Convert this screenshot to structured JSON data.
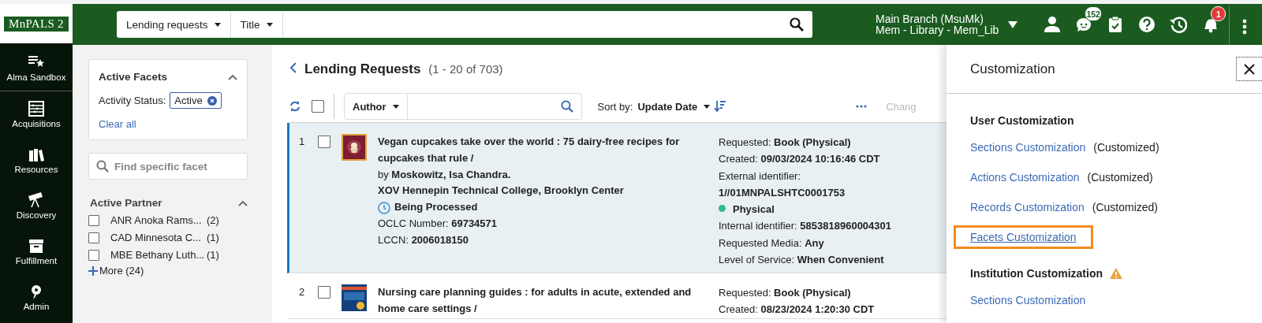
{
  "topbar": {
    "logo": "MnPALS 2",
    "search": {
      "scope": "Lending requests",
      "field": "Title"
    },
    "location": {
      "line_1": "Main Branch (MsuMk)",
      "line_2": "Mem - Library - Mem_Lib"
    },
    "icons": [
      {
        "kind": "user"
      },
      {
        "kind": "chat",
        "badge": "152"
      },
      {
        "kind": "tasks"
      },
      {
        "kind": "help"
      },
      {
        "kind": "history"
      },
      {
        "kind": "alerts",
        "badge": "1"
      },
      {
        "kind": "more"
      }
    ]
  },
  "nav": {
    "items": [
      {
        "label": "Alma Sandbox",
        "kind": "sandbox"
      },
      {
        "label": "Acquisitions",
        "kind": "acquisitions"
      },
      {
        "label": "Resources",
        "kind": "resources"
      },
      {
        "label": "Discovery",
        "kind": "discovery"
      },
      {
        "label": "Fulfillment",
        "kind": "fulfillment"
      },
      {
        "label": "Admin",
        "kind": "admin"
      }
    ]
  },
  "facets": {
    "active": {
      "title": "Active Facets",
      "expanded": true,
      "filter_label": "Activity Status:",
      "filter_value": "Active",
      "clear": "Clear all"
    },
    "find_placeholder": "Find specific facet",
    "groups": [
      {
        "title": "Active Partner",
        "expanded": true,
        "items": [
          {
            "label": "ANR Anoka Rams...",
            "count": "(2)",
            "checked": false
          },
          {
            "label": "CAD Minnesota C...",
            "count": "(1)",
            "checked": false
          },
          {
            "label": "MBE Bethany Luth...",
            "count": "(1)",
            "checked": false
          }
        ],
        "more": "More (24)"
      }
    ]
  },
  "list": {
    "title": "Lending Requests",
    "range": "(1 - 20 of 703)",
    "toolbar": {
      "select_all_checked": false,
      "search_field": "Author",
      "sort_label": "Sort by:",
      "sort_value": "Update Date",
      "change": "Chang"
    },
    "rows": [
      {
        "number": "1",
        "checked": false,
        "selected": true,
        "title": "Vegan cupcakes take over the world : 75 dairy-free recipes for cupcakes that rule /",
        "by": "by",
        "author": "Moskowitz, Isa Chandra.",
        "partner": "XOV Hennepin Technical College, Brooklyn Center",
        "status": "Being Processed",
        "ids": [
          {
            "label": "OCLC Number:",
            "value": "69734571"
          },
          {
            "label": "LCCN:",
            "value": "2006018150"
          }
        ],
        "details": [
          {
            "kind": "pair",
            "label": "Requested:",
            "value": "Book (Physical)"
          },
          {
            "kind": "pair",
            "label": "Created:",
            "value": "09/03/2024 10:16:46 CDT"
          },
          {
            "kind": "label",
            "label": "External identifier:"
          },
          {
            "kind": "value",
            "value": "1//01MNPALSHTC0001753"
          },
          {
            "kind": "dot",
            "value": "Physical",
            "color": "#2dbd8b"
          },
          {
            "kind": "pair",
            "label": "Internal identifier:",
            "value": "5853818960004301"
          },
          {
            "kind": "pair",
            "label": "Requested Media:",
            "value": "Any"
          },
          {
            "kind": "pair",
            "label": "Level of Service:",
            "value": "When Convenient"
          }
        ]
      },
      {
        "number": "2",
        "checked": false,
        "selected": false,
        "title": "Nursing care planning guides : for adults in acute, extended and home care settings /",
        "details": [
          {
            "kind": "pair",
            "label": "Requested:",
            "value": "Book (Physical)"
          },
          {
            "kind": "pair",
            "label": "Created:",
            "value": "08/23/2024 1:20:30 CDT"
          }
        ]
      }
    ]
  },
  "customization": {
    "title": "Customization",
    "sections": [
      {
        "title": "User Customization",
        "warning": false,
        "links": [
          {
            "label": "Sections Customization",
            "note": "(Customized)",
            "highlighted": false
          },
          {
            "label": "Actions Customization",
            "note": "(Customized)",
            "highlighted": false
          },
          {
            "label": "Records Customization",
            "note": "(Customized)",
            "highlighted": false
          },
          {
            "label": "Facets Customization",
            "highlighted": true
          }
        ]
      },
      {
        "title": "Institution Customization",
        "warning": true,
        "links": [
          {
            "label": "Sections Customization",
            "highlighted": false
          }
        ]
      }
    ]
  }
}
